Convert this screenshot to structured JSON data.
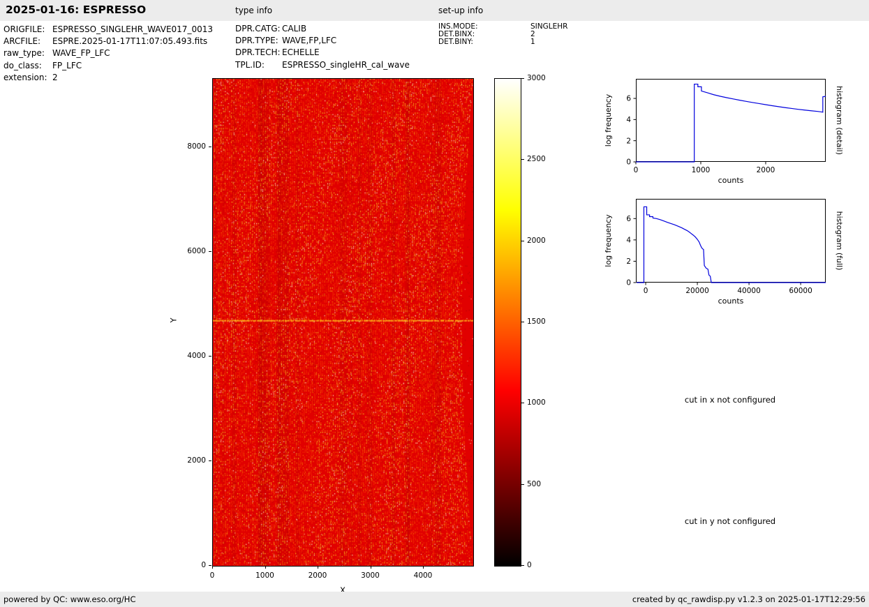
{
  "header": {
    "title": "2025-01-16: ESPRESSO",
    "type_info_label": "type info",
    "setup_info_label": "set-up info"
  },
  "file_info": {
    "rows": [
      {
        "label": "ORIGFILE:",
        "value": "ESPRESSO_SINGLEHR_WAVE017_0013"
      },
      {
        "label": "ARCFILE:",
        "value": "ESPRE.2025-01-17T11:07:05.493.fits"
      },
      {
        "label": "raw_type:",
        "value": "WAVE_FP_LFC"
      },
      {
        "label": "do_class:",
        "value": "FP_LFC"
      },
      {
        "label": "extension:",
        "value": "2"
      }
    ]
  },
  "type_info": {
    "rows": [
      {
        "label": "DPR.CATG:",
        "value": "CALIB"
      },
      {
        "label": "DPR.TYPE:",
        "value": "WAVE,FP,LFC"
      },
      {
        "label": "DPR.TECH:",
        "value": "ECHELLE"
      },
      {
        "label": "TPL.ID:",
        "value": "ESPRESSO_singleHR_cal_wave"
      }
    ]
  },
  "setup_info": {
    "rows": [
      {
        "label": "INS.MODE:",
        "value": "SINGLEHR"
      },
      {
        "label": "DET.BINX:",
        "value": "2"
      },
      {
        "label": "DET.BINY:",
        "value": "1"
      }
    ]
  },
  "messages": {
    "cut_x": "cut in x not configured",
    "cut_y": "cut in y not configured"
  },
  "footer": {
    "left": "powered by QC: www.eso.org/HC",
    "right": "created by qc_rawdisp.py v1.2.3 on 2025-01-17T12:29:56"
  },
  "chart_data": [
    {
      "type": "heatmap",
      "name": "raw-frame",
      "xlabel": "X",
      "ylabel": "Y",
      "xlim": [
        0,
        4940
      ],
      "ylim": [
        0,
        9307
      ],
      "x_ticks": [
        0,
        1000,
        2000,
        3000,
        4000
      ],
      "y_ticks": [
        0,
        2000,
        4000,
        6000,
        8000
      ],
      "colorbar": {
        "range": [
          0,
          3000
        ],
        "ticks": [
          0,
          500,
          1000,
          1500,
          2000,
          2500,
          3000
        ],
        "colormap": "hot",
        "stops": [
          "#000000 0%",
          "#ff0000 36%",
          "#ffff00 73%",
          "#ffffff 100%"
        ]
      },
      "description": "ESPRESSO echelle raw calibration frame (WAVE FP/LFC): dense vertical order stripes, background ~1000-1200 counts (red) speckled with FP/LFC emission dots up to 3000 counts (yellow/white)",
      "base_level_counts": 1100,
      "peak_counts": 3000,
      "annotations": [
        {
          "type": "horizontal-line",
          "y": 4690,
          "description": "bright horizontal stripe across frame"
        }
      ],
      "palette": {
        "background": "#e10000",
        "dim": "#f93a00",
        "mid": "#ff7a00",
        "bright": "#ffdd22",
        "peak": "#fff7c0",
        "dark_speck": "#a50000",
        "hline": "#ffd028",
        "hline2": "#ff9900"
      }
    },
    {
      "type": "line",
      "name": "histogram-detail",
      "side_label": "histogram (detail)",
      "xlabel": "counts",
      "ylabel": "log frequency",
      "xlim": [
        0,
        2925
      ],
      "ylim": [
        0,
        7.85
      ],
      "x_ticks": [
        0,
        1000,
        2000
      ],
      "y_ticks": [
        0,
        2,
        4,
        6
      ],
      "line_color": "#0000dd",
      "points": [
        [
          0,
          0
        ],
        [
          900,
          0
        ],
        [
          900,
          7.35
        ],
        [
          955,
          7.35
        ],
        [
          955,
          7.1
        ],
        [
          1010,
          7.1
        ],
        [
          1010,
          6.7
        ],
        [
          1065,
          6.6
        ],
        [
          1120,
          6.5
        ],
        [
          1200,
          6.35
        ],
        [
          1300,
          6.2
        ],
        [
          1400,
          6.07
        ],
        [
          1500,
          5.95
        ],
        [
          1600,
          5.83
        ],
        [
          1700,
          5.72
        ],
        [
          1800,
          5.61
        ],
        [
          1900,
          5.51
        ],
        [
          2000,
          5.41
        ],
        [
          2100,
          5.31
        ],
        [
          2200,
          5.22
        ],
        [
          2300,
          5.13
        ],
        [
          2400,
          5.05
        ],
        [
          2500,
          4.97
        ],
        [
          2600,
          4.9
        ],
        [
          2700,
          4.83
        ],
        [
          2800,
          4.77
        ],
        [
          2860,
          4.72
        ],
        [
          2880,
          4.7
        ],
        [
          2880,
          6.15
        ],
        [
          2925,
          6.2
        ]
      ]
    },
    {
      "type": "line",
      "name": "histogram-full",
      "side_label": "histogram (full)",
      "xlabel": "counts",
      "ylabel": "log frequency",
      "xlim": [
        -3800,
        69700
      ],
      "ylim": [
        0,
        7.85
      ],
      "x_ticks": [
        0,
        20000,
        40000,
        60000
      ],
      "y_ticks": [
        0,
        2,
        4,
        6
      ],
      "line_color": "#0000dd",
      "points": [
        [
          -3500,
          0
        ],
        [
          -700,
          0
        ],
        [
          -700,
          7.1
        ],
        [
          400,
          7.1
        ],
        [
          400,
          6.35
        ],
        [
          1500,
          6.35
        ],
        [
          1500,
          6.18
        ],
        [
          2800,
          6.18
        ],
        [
          2800,
          6.05
        ],
        [
          4200,
          6.0
        ],
        [
          5600,
          5.9
        ],
        [
          7000,
          5.78
        ],
        [
          8400,
          5.65
        ],
        [
          9800,
          5.53
        ],
        [
          11200,
          5.42
        ],
        [
          12600,
          5.28
        ],
        [
          14000,
          5.13
        ],
        [
          15000,
          5.0
        ],
        [
          16000,
          4.88
        ],
        [
          16800,
          4.75
        ],
        [
          17600,
          4.6
        ],
        [
          18400,
          4.45
        ],
        [
          19200,
          4.28
        ],
        [
          20000,
          4.05
        ],
        [
          20700,
          3.8
        ],
        [
          21200,
          3.5
        ],
        [
          21700,
          3.25
        ],
        [
          22100,
          3.15
        ],
        [
          22400,
          3.1
        ],
        [
          22700,
          1.6
        ],
        [
          23400,
          1.35
        ],
        [
          24100,
          1.25
        ],
        [
          24500,
          0.7
        ],
        [
          25000,
          0.6
        ],
        [
          25400,
          0
        ],
        [
          69700,
          0
        ]
      ]
    }
  ]
}
